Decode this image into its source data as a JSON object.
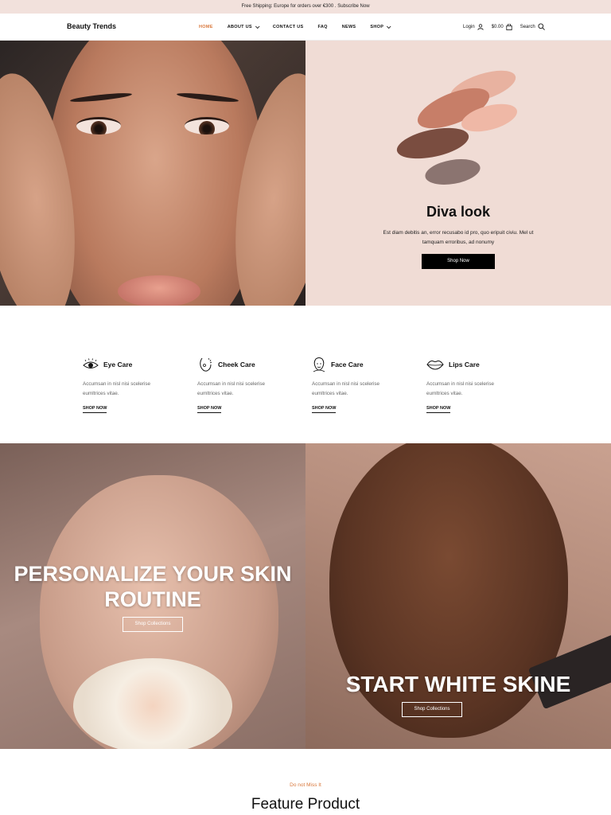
{
  "topbar": {
    "text": "Free Shipping: Europe for orders over €300 . Subscribe Now"
  },
  "header": {
    "logo": "Beauty Trends",
    "nav": [
      "HOME",
      "ABOUT US",
      "CONTACT US",
      "FAQ",
      "NEWS",
      "SHOP"
    ],
    "login": "Login",
    "cart": "$0.00",
    "search": "Search",
    "accent": "#d9773b"
  },
  "hero": {
    "title": "Diva look",
    "text": "Est diam debitis an, error recusabo id pro, quo eripuit civiu. Mel ut tamquam erroribus, ad nonumy",
    "button": "Shop Now",
    "bg": "#f0dcd5"
  },
  "care": [
    {
      "title": "Eye Care",
      "desc": "Accumsan in nisl nisi scelerise eumltrices vitae.",
      "link": "SHOP NOW",
      "icon": "eye-icon"
    },
    {
      "title": "Cheek Care",
      "desc": "Accumsan in nisl nisi scelerise eumltrices vitae.",
      "link": "SHOP NOW",
      "icon": "cheek-icon"
    },
    {
      "title": "Face Care",
      "desc": "Accumsan in nisl nisi scelerise eumltrices vitae.",
      "link": "SHOP NOW",
      "icon": "face-icon"
    },
    {
      "title": "Lips Care",
      "desc": "Accumsan in nisl nisi scelerise eumltrices vitae.",
      "link": "SHOP NOW",
      "icon": "lips-icon"
    }
  ],
  "banners": {
    "left": {
      "title_line1": "PERSONALIZE YOUR SKIN",
      "title_line2": "ROUTINE",
      "button": "Shop Collections"
    },
    "right": {
      "title": "START WHITE SKINE",
      "button": "Shop Collections"
    }
  },
  "feature": {
    "label": "Do not Miss It",
    "title": "Feature Product"
  }
}
